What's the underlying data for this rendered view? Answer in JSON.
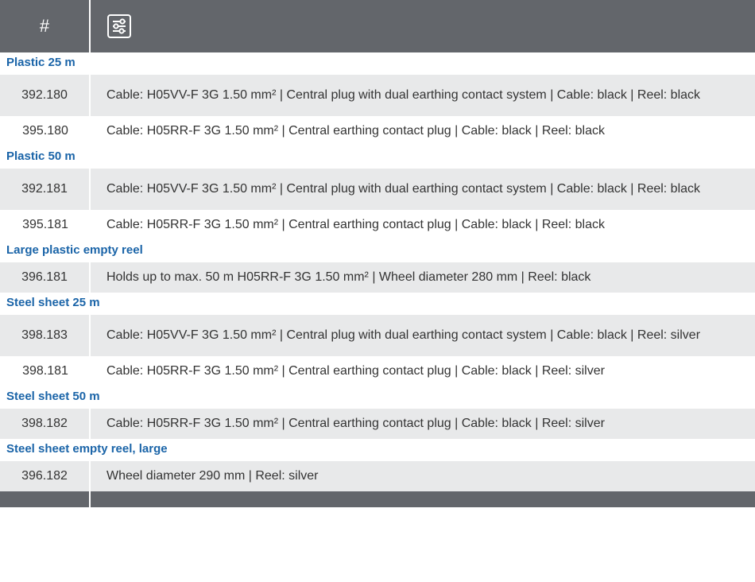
{
  "header": {
    "hash_label": "#",
    "filter_icon": "filter-settings-icon",
    "bg_color": "#63666b",
    "accent_color": "#1a64a8"
  },
  "groups": [
    {
      "title": "Plastic 25 m",
      "rows": [
        {
          "number": "392.180",
          "description": "Cable: H05VV-F 3G 1.50 mm² | Central plug with dual earthing contact system | Cable: black | Reel: black"
        },
        {
          "number": "395.180",
          "description": "Cable: H05RR-F 3G 1.50 mm² | Central earthing contact plug | Cable: black | Reel: black"
        }
      ]
    },
    {
      "title": "Plastic 50 m",
      "rows": [
        {
          "number": "392.181",
          "description": "Cable: H05VV-F 3G 1.50 mm² | Central plug with dual earthing contact system | Cable: black | Reel: black"
        },
        {
          "number": "395.181",
          "description": "Cable: H05RR-F 3G 1.50 mm² | Central earthing contact plug | Cable: black | Reel: black"
        }
      ]
    },
    {
      "title": "Large plastic empty reel",
      "rows": [
        {
          "number": "396.181",
          "description": "Holds up to max. 50 m H05RR-F 3G 1.50 mm² | Wheel diameter 280 mm | Reel: black"
        }
      ]
    },
    {
      "title": "Steel sheet 25 m",
      "rows": [
        {
          "number": "398.183",
          "description": "Cable: H05VV-F 3G 1.50 mm² | Central plug with dual earthing contact system | Cable: black | Reel: silver"
        },
        {
          "number": "398.181",
          "description": "Cable: H05RR-F 3G 1.50 mm² | Central earthing contact plug | Cable: black | Reel: silver"
        }
      ]
    },
    {
      "title": "Steel sheet 50 m",
      "rows": [
        {
          "number": "398.182",
          "description": "Cable: H05RR-F 3G 1.50 mm² | Central earthing contact plug | Cable: black | Reel: silver"
        }
      ]
    },
    {
      "title": "Steel sheet empty reel, large",
      "rows": [
        {
          "number": "396.182",
          "description": "Wheel diameter 290 mm | Reel: silver"
        }
      ]
    }
  ]
}
